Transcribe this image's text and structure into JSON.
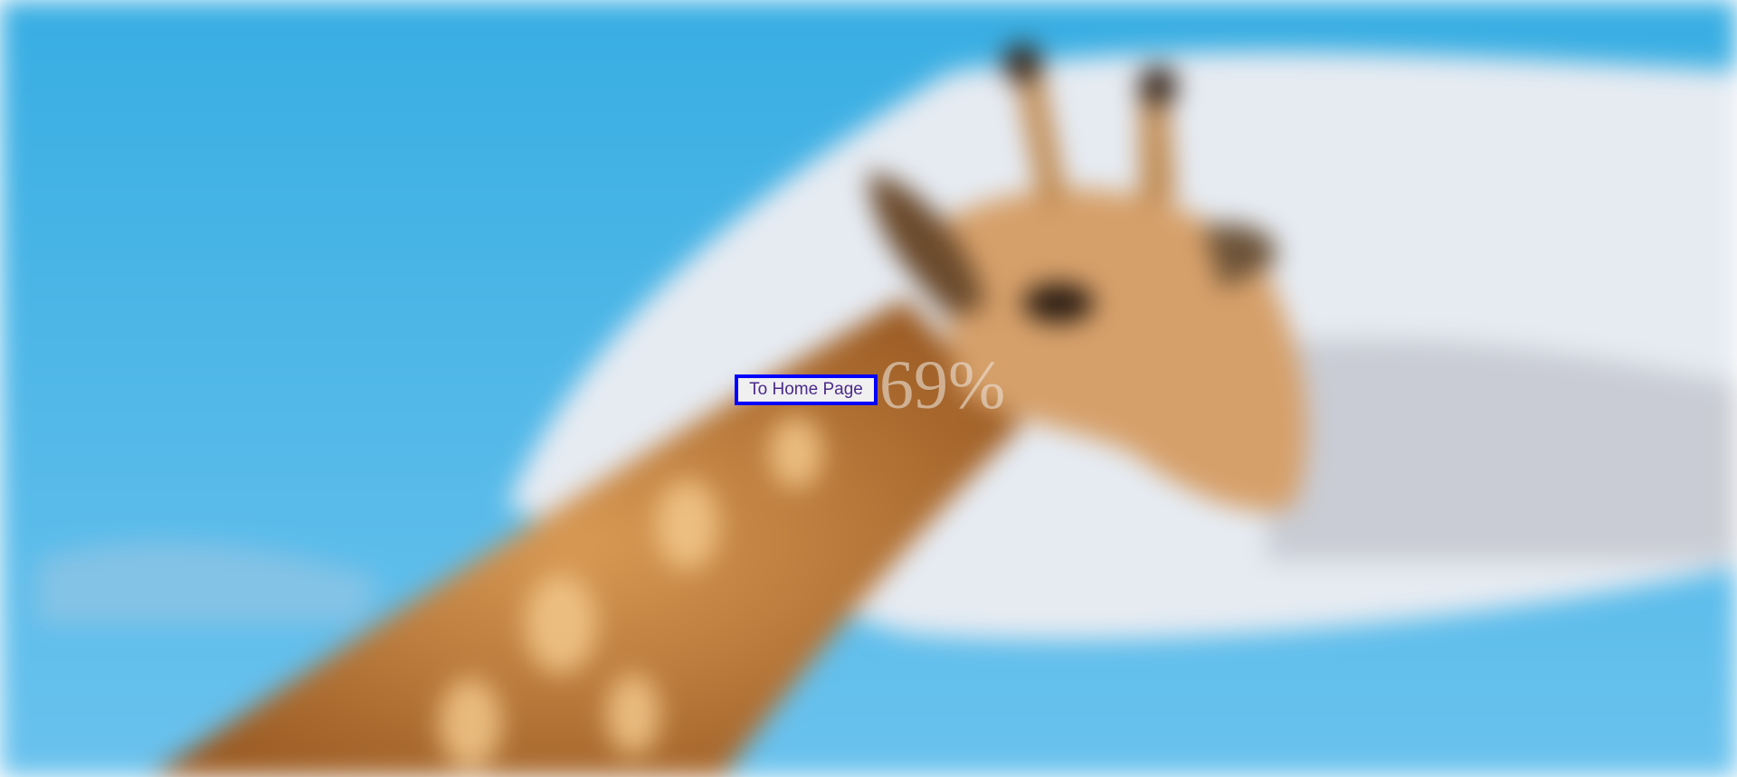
{
  "background": {
    "image": "blurred giraffe against blue sky with clouds",
    "sky_color": "#3bb0e3"
  },
  "home_button": {
    "label": "To Home Page",
    "border_color": "#0000ff"
  },
  "progress": {
    "text": "69%",
    "value": 69
  }
}
